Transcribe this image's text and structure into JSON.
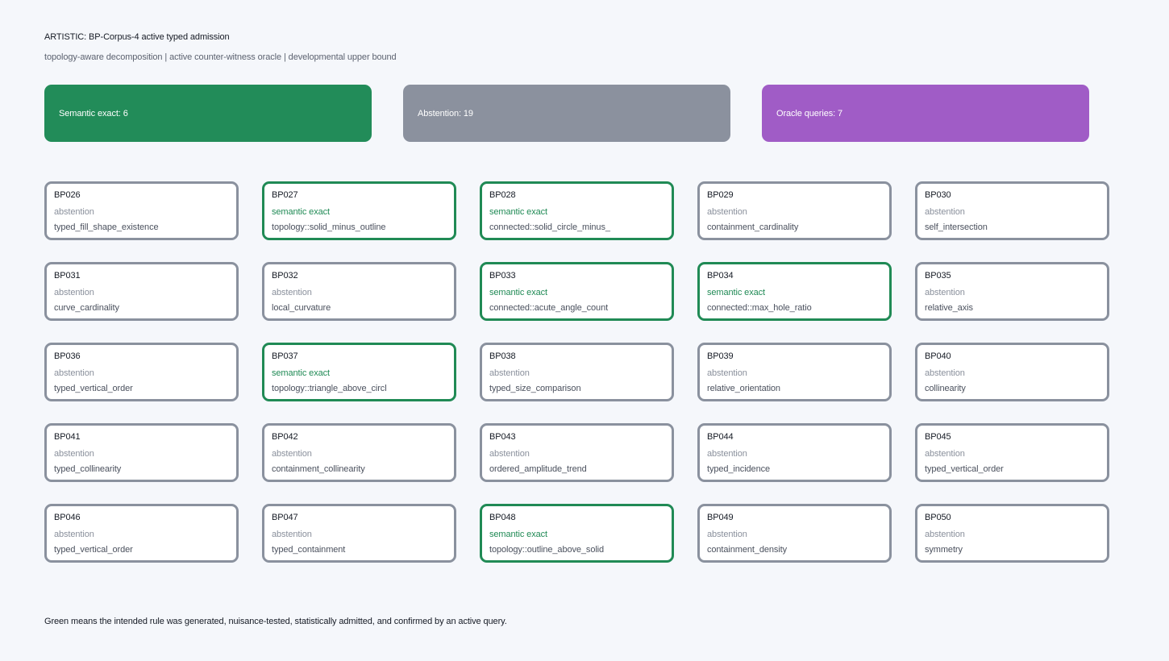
{
  "title": "ARTISTIC: BP-Corpus-4 active typed admission",
  "subtitle": "topology-aware decomposition | active counter-witness oracle | developmental upper bound",
  "colors": {
    "exact": "#208a55",
    "abstention": "#8b919e",
    "oracle": "#a05cc6",
    "background": "#f5f7fb"
  },
  "stats": [
    {
      "label": "Semantic exact: 6",
      "color": "#228c59"
    },
    {
      "label": "Abstention: 19",
      "color": "#8b919e"
    },
    {
      "label": "Oracle queries: 7",
      "color": "#a05cc6"
    }
  ],
  "cards": [
    {
      "id": "BP026",
      "status": "abstention",
      "rule": "typed_fill_shape_existence"
    },
    {
      "id": "BP027",
      "status": "semantic exact",
      "rule": "topology::solid_minus_outline"
    },
    {
      "id": "BP028",
      "status": "semantic exact",
      "rule": "connected::solid_circle_minus_"
    },
    {
      "id": "BP029",
      "status": "abstention",
      "rule": "containment_cardinality"
    },
    {
      "id": "BP030",
      "status": "abstention",
      "rule": "self_intersection"
    },
    {
      "id": "BP031",
      "status": "abstention",
      "rule": "curve_cardinality"
    },
    {
      "id": "BP032",
      "status": "abstention",
      "rule": "local_curvature"
    },
    {
      "id": "BP033",
      "status": "semantic exact",
      "rule": "connected::acute_angle_count"
    },
    {
      "id": "BP034",
      "status": "semantic exact",
      "rule": "connected::max_hole_ratio"
    },
    {
      "id": "BP035",
      "status": "abstention",
      "rule": "relative_axis"
    },
    {
      "id": "BP036",
      "status": "abstention",
      "rule": "typed_vertical_order"
    },
    {
      "id": "BP037",
      "status": "semantic exact",
      "rule": "topology::triangle_above_circl"
    },
    {
      "id": "BP038",
      "status": "abstention",
      "rule": "typed_size_comparison"
    },
    {
      "id": "BP039",
      "status": "abstention",
      "rule": "relative_orientation"
    },
    {
      "id": "BP040",
      "status": "abstention",
      "rule": "collinearity"
    },
    {
      "id": "BP041",
      "status": "abstention",
      "rule": "typed_collinearity"
    },
    {
      "id": "BP042",
      "status": "abstention",
      "rule": "containment_collinearity"
    },
    {
      "id": "BP043",
      "status": "abstention",
      "rule": "ordered_amplitude_trend"
    },
    {
      "id": "BP044",
      "status": "abstention",
      "rule": "typed_incidence"
    },
    {
      "id": "BP045",
      "status": "abstention",
      "rule": "typed_vertical_order"
    },
    {
      "id": "BP046",
      "status": "abstention",
      "rule": "typed_vertical_order"
    },
    {
      "id": "BP047",
      "status": "abstention",
      "rule": "typed_containment"
    },
    {
      "id": "BP048",
      "status": "semantic exact",
      "rule": "topology::outline_above_solid"
    },
    {
      "id": "BP049",
      "status": "abstention",
      "rule": "containment_density"
    },
    {
      "id": "BP050",
      "status": "abstention",
      "rule": "symmetry"
    }
  ],
  "footer": "Green means the intended rule was generated, nuisance-tested, statistically admitted, and confirmed by an active query."
}
